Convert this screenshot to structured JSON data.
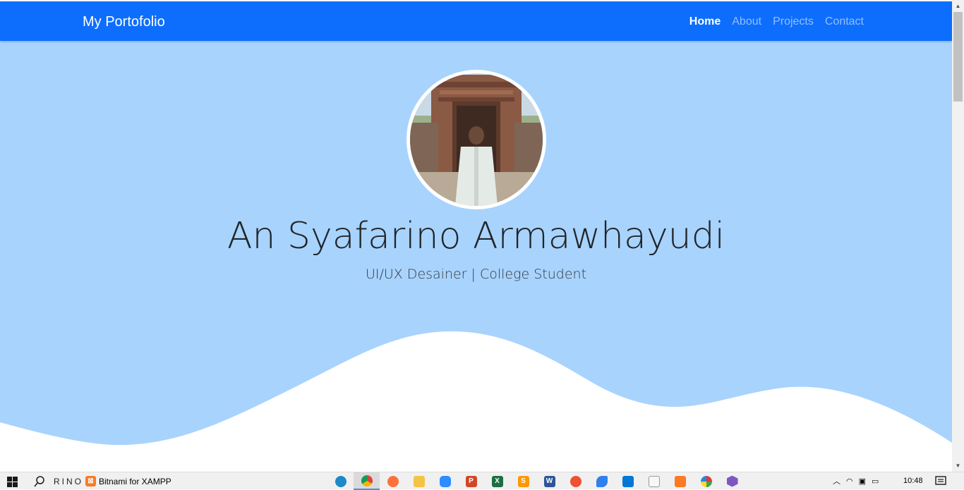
{
  "navbar": {
    "brand": "My Portofolio",
    "links": [
      {
        "label": "Home",
        "active": true
      },
      {
        "label": "About",
        "active": false
      },
      {
        "label": "Projects",
        "active": false
      },
      {
        "label": "Contact",
        "active": false
      }
    ]
  },
  "hero": {
    "name": "An Syafarino Armawhayudi",
    "subtitle": "UI/UX Desainer | College Student",
    "avatar_icon": "profile-photo"
  },
  "colors": {
    "navbar_bg": "#0d6efd",
    "hero_bg": "#a8d3fd",
    "wave": "#ffffff"
  },
  "taskbar": {
    "user": "RINO",
    "xampp_label": "Bitnami for XAMPP",
    "clock": "10:48",
    "apps": [
      "edge-icon",
      "chrome-icon",
      "firefox-icon",
      "file-explorer-icon",
      "zoom-icon",
      "powerpoint-icon",
      "excel-icon",
      "sublime-text-icon",
      "word-icon",
      "git-icon",
      "app-bird-icon",
      "vscode-icon",
      "notepad-icon",
      "xampp-icon",
      "app-colors-icon",
      "app-hex-icon"
    ]
  }
}
